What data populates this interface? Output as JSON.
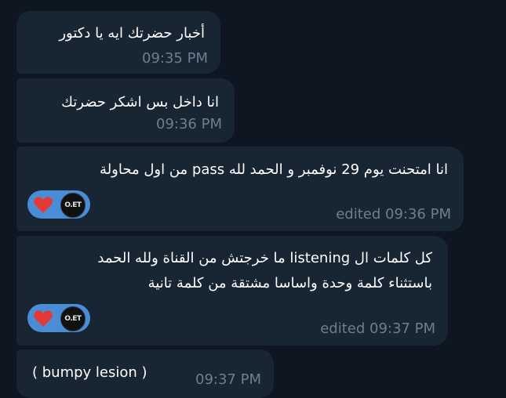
{
  "colors": {
    "background": "#0e1621",
    "bubble": "#182533",
    "text": "#ffffff",
    "meta": "#6d7f8f",
    "reaction_pill": "#4a8cd6",
    "heart": "#e53935"
  },
  "messages": [
    {
      "text": "أخبار حضرتك ايه يا دكتور",
      "time": "09:35 PM"
    },
    {
      "text": "انا داخل بس اشكر حضرتك",
      "time": "09:36 PM"
    },
    {
      "text": "انا امتحنت يوم 29 نوفمبر و الحمد لله pass من اول محاولة",
      "time": "edited 09:36 PM",
      "reactions": [
        {
          "icon": "heart-icon"
        },
        {
          "avatar_text": "O.ET"
        }
      ]
    },
    {
      "line1": "كل كلمات ال listening  ما خرجتش من القناة ولله الحمد",
      "line2": "باستثناء كلمة وحدة واساسا مشتقة من كلمة تانية",
      "time": "edited 09:37 PM",
      "reactions": [
        {
          "icon": "heart-icon"
        },
        {
          "avatar_text": "O.ET"
        }
      ]
    },
    {
      "text": "( bumpy lesion )",
      "time": "09:37 PM"
    }
  ]
}
